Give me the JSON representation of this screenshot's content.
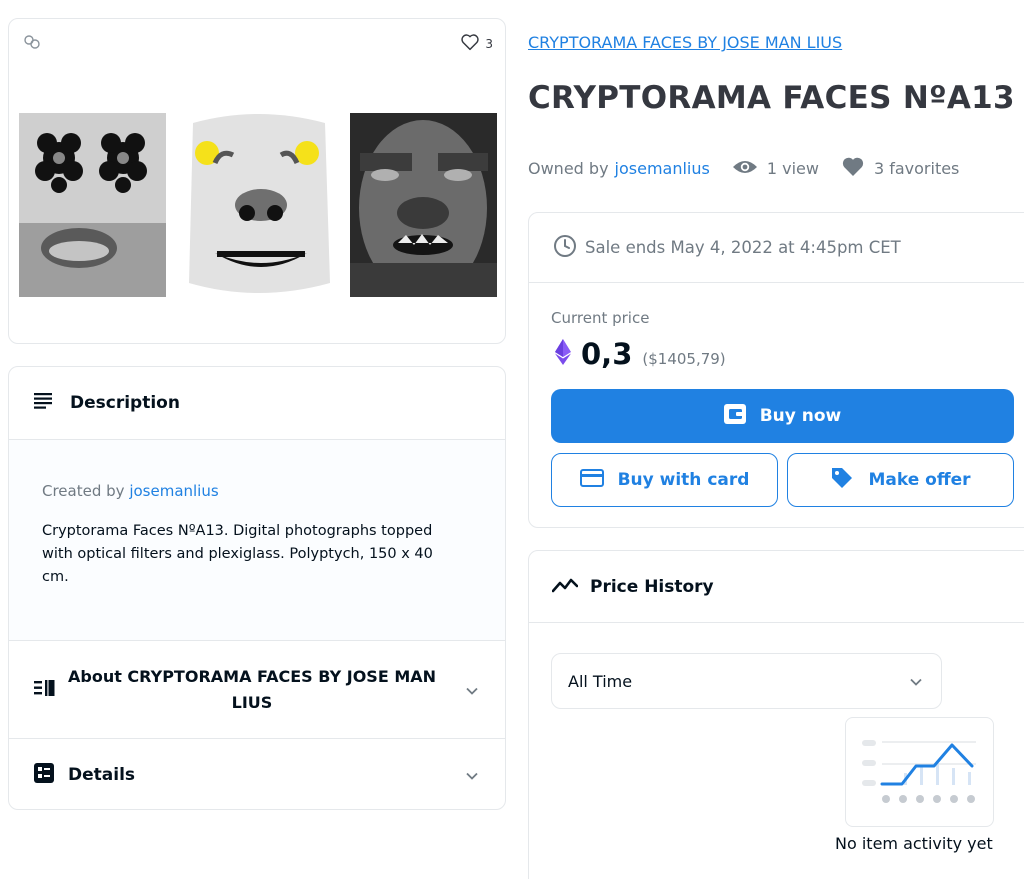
{
  "media": {
    "favorites_count": "3",
    "icons": {
      "top_left": "link-icon",
      "favorite": "heart-outline-icon"
    }
  },
  "description": {
    "heading": "Description",
    "created_by_prefix": "Created by",
    "creator": "josemanlius",
    "text": "Cryptorama Faces NºA13. Digital photographs topped with optical filters and plexiglass. Polyptych, 150 x 40 cm.",
    "about_heading": "About CRYPTORAMA FACES BY JOSE MAN LIUS",
    "details_heading": "Details"
  },
  "item": {
    "collection": "CRYPTORAMA FACES BY JOSE MAN LIUS",
    "title": "CRYPTORAMA FACES NºA13",
    "owned_by_prefix": "Owned by",
    "owner": "josemanlius",
    "views": "1 view",
    "favorites": "3 favorites"
  },
  "sale": {
    "ends": "Sale ends May 4, 2022 at 4:45pm CET",
    "price_label": "Current price",
    "price": "0,3",
    "price_usd": "($1405,79)",
    "buy_now": "Buy now",
    "buy_card": "Buy with card",
    "make_offer": "Make offer"
  },
  "history": {
    "heading": "Price History",
    "range": "All Time",
    "empty": "No item activity yet"
  },
  "colors": {
    "accent": "#2081e2",
    "text": "#04111d",
    "muted": "#707a83",
    "eth": "#8a5cf6",
    "eyes": "#f5e11a"
  }
}
